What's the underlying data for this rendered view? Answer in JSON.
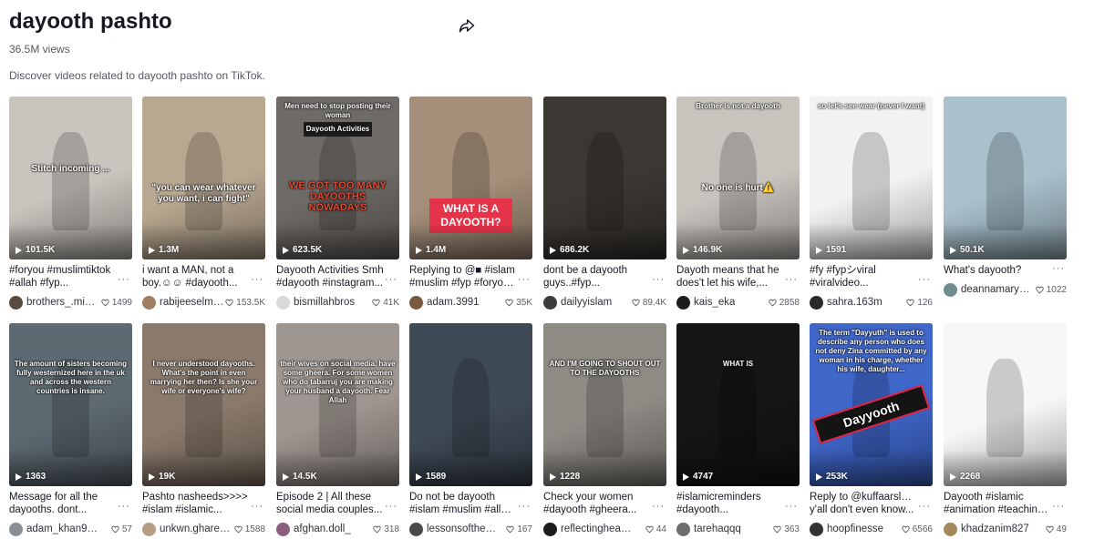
{
  "page": {
    "title": "dayooth pashto",
    "views": "36.5M views",
    "description": "Discover videos related to dayooth pashto on TikTok.",
    "share_icon": "share-arrow-icon"
  },
  "videos": [
    {
      "plays": "101.5K",
      "caption1": "#foryou #muslimtiktok",
      "caption2": "#allah #fyp...",
      "user": "brothers_.min...",
      "likes": "1499",
      "overlay": "Stitch incoming ...",
      "bg": "#c9c4bd",
      "avatar": "#5b4a3f"
    },
    {
      "plays": "1.3M",
      "caption1": "i want a MAN, not a",
      "caption2": "boy.☺☺ #dayooth...",
      "user": "rabijeeselma...",
      "likes": "153.5K",
      "overlay": "\"you can wear whatever you want, i can fight\"",
      "bg": "#b9a891",
      "avatar": "#a07d63"
    },
    {
      "plays": "623.5K",
      "caption1": "Dayooth Activities Smh",
      "caption2": "#dayooth #instagram...",
      "user": "bismillahbros",
      "likes": "41K",
      "overlay": "WE GOT TOO MANY DAYOOTHS NOWADAYS",
      "overlay_top": "Men need to stop posting their woman",
      "overlay_tag": "Dayooth Activities",
      "bg": "#6e6a66",
      "avatar": "#d9d9d9"
    },
    {
      "plays": "1.4M",
      "caption1": "Replying to @■ #islam",
      "caption2": "#muslim #fyp #foryou...",
      "user": "adam.3991",
      "likes": "35K",
      "overlay": "WHAT IS A DAYOOTH?",
      "bg": "#a58f7a",
      "avatar": "#7a5a3e"
    },
    {
      "plays": "686.2K",
      "caption1": "dont be a dayooth",
      "caption2": "guys..#fyp...",
      "user": "dailyyislam",
      "likes": "89.4K",
      "overlay": "",
      "bg": "#3b3733",
      "avatar": "#3c3c3c"
    },
    {
      "plays": "146.9K",
      "caption1": "Dayoth means that he",
      "caption2": "does't let his wife,...",
      "user": "kais_eka",
      "likes": "2858",
      "overlay": "No one is hurt⚠️",
      "overlay_top": "Brother is not a dayooth",
      "bg": "#c8c3bd",
      "avatar": "#1d1d1d"
    },
    {
      "plays": "1591",
      "caption1": "#fy #fypシviral",
      "caption2": "#viralvideo...",
      "user": "sahra.163m",
      "likes": "126",
      "overlay": "",
      "overlay_top": "so let's see wear (never I want)",
      "bg": "#f2f2f2",
      "avatar": "#2a2a2a"
    },
    {
      "plays": "50.1K",
      "caption1": "What's dayooth?",
      "caption2": "",
      "user": "deannamaryam",
      "likes": "1022",
      "overlay": "",
      "bg": "#a9c1cc",
      "avatar": "#6f8c8e"
    },
    {
      "plays": "1363",
      "caption1": "Message for all the",
      "caption2": "dayooths. dont...",
      "user": "adam_khan999",
      "likes": "57",
      "overlay": "The amount of sisters becoming fully westernized here in the uk and across the western countries is insane.",
      "bg": "#5d6a71",
      "avatar": "#8a8f95"
    },
    {
      "plays": "19K",
      "caption1": "Pashto nasheeds>>>>",
      "caption2": "#islam #islamic...",
      "user": "unkwn.gharee...",
      "likes": "1588",
      "overlay": "I never understood dayooths. What's the point in even marrying her then? Is she your wife or everyone's wife?",
      "bg": "#8a7a6c",
      "avatar": "#b59e84"
    },
    {
      "plays": "14.5K",
      "caption1": "Episode 2 | All these",
      "caption2": "social media couples...",
      "user": "afghan.doll_",
      "likes": "318",
      "overlay": "their wives on social media, have some gheera. For some women who do tabarruj you are making your husband a dayooth. Fear Allah",
      "bg": "#9e9690",
      "avatar": "#8a5f7e"
    },
    {
      "plays": "1589",
      "caption1": "Do not be dayooth",
      "caption2": "#islam #muslim #allah...",
      "user": "lessonsofthede...",
      "likes": "167",
      "overlay": "",
      "bg": "#3f4a57",
      "avatar": "#4a4a4a"
    },
    {
      "plays": "1228",
      "caption1": "Check your women",
      "caption2": "#dayooth #gheera...",
      "user": "reflectinghearts",
      "likes": "44",
      "overlay": "AND I'M GOING TO SHOUT OUT TO THE DAYOOTHS",
      "bg": "#8e8a84",
      "avatar": "#1d1d1d"
    },
    {
      "plays": "4747",
      "caption1": "#islamicreminders",
      "caption2": "#dayooth...",
      "user": "tarehaqqq",
      "likes": "363",
      "overlay": "WHAT IS",
      "bg": "#151515",
      "avatar": "#6d6d6d"
    },
    {
      "plays": "253K",
      "caption1": "Reply to @kuffaarslayer",
      "caption2": "y'all don't even know...",
      "user": "hoopfinesse",
      "likes": "6566",
      "overlay": "Dayyooth",
      "overlay_top": "The term \"Dayyuth\" is used to describe any person who does not deny Zina committed by any woman in his charge, whether his wife, daughter...",
      "bg": "#3f66c9",
      "avatar": "#333333"
    },
    {
      "plays": "2268",
      "caption1": "Dayooth #islamic",
      "caption2": "#animation #teaching...",
      "user": "khadzanim827",
      "likes": "49",
      "overlay": "",
      "bg": "#f7f7f5",
      "avatar": "#a48a5a"
    }
  ]
}
